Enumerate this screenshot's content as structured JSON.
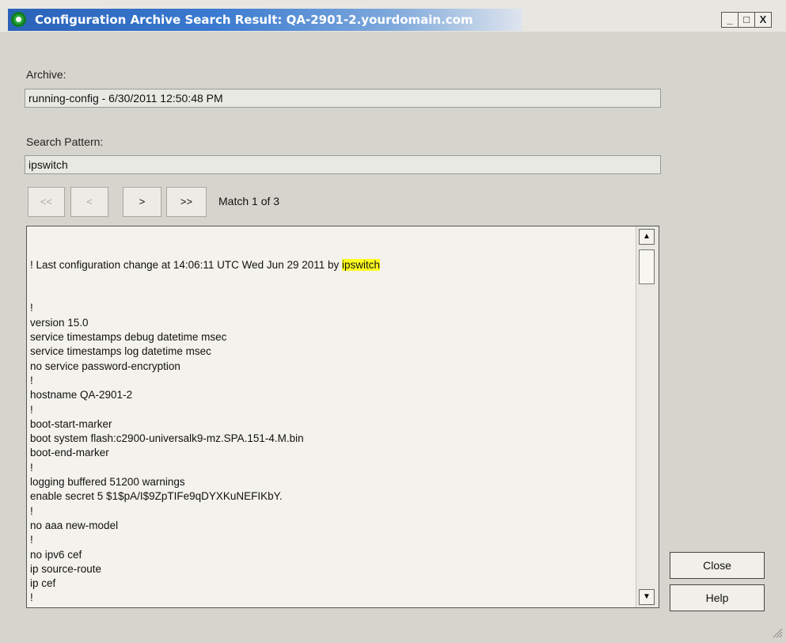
{
  "window": {
    "title": "Configuration Archive Search Result: QA-2901-2.yourdomain.com",
    "controls": [
      "_",
      "□",
      "X"
    ]
  },
  "archive": {
    "label": "Archive:",
    "value": "running-config - 6/30/2011 12:50:48 PM"
  },
  "search": {
    "label": "Search Pattern:",
    "value": "ipswitch"
  },
  "navigation": {
    "first_label": "<<",
    "prev_label": "<",
    "next_label": ">",
    "last_label": ">>",
    "match_status": "Match 1 of 3"
  },
  "config": {
    "first_line_prefix": "! Last configuration change at 14:06:11 UTC Wed Jun 29 2011 by ",
    "first_line_match": "ipswitch",
    "lines": [
      "!",
      "version 15.0",
      "service timestamps debug datetime msec",
      "service timestamps log datetime msec",
      "no service password-encryption",
      "!",
      "hostname QA-2901-2",
      "!",
      "boot-start-marker",
      "boot system flash:c2900-universalk9-mz.SPA.151-4.M.bin",
      "boot-end-marker",
      "!",
      "logging buffered 51200 warnings",
      "enable secret 5 $1$pA/I$9ZpTIFe9qDYXKuNEFIKbY.",
      "!",
      "no aaa new-model",
      "!",
      "no ipv6 cef",
      "ip source-route",
      "ip cef",
      "!",
      "!"
    ]
  },
  "buttons": {
    "close_label": "Close",
    "help_label": "Help"
  }
}
